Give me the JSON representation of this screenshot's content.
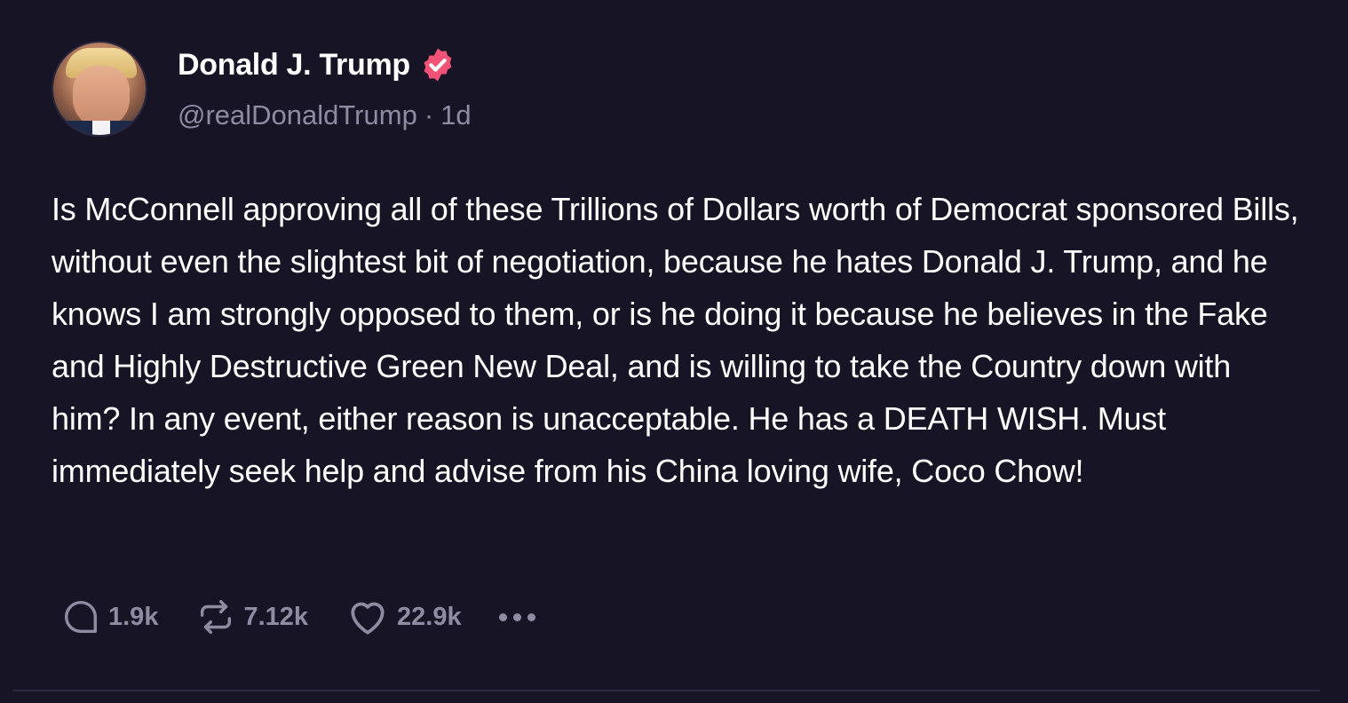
{
  "author": {
    "display_name": "Donald J. Trump",
    "handle": "@realDonaldTrump",
    "separator": "·",
    "time_ago": "1d",
    "verified": true
  },
  "post": {
    "text": "Is McConnell approving all of these Trillions of Dollars worth of Democrat sponsored Bills, without even the slightest bit of negotiation, because he hates Donald J. Trump, and he knows I am strongly opposed to them, or is he doing it because he believes in the Fake and Highly Destructive Green New Deal, and is willing to take the Country down with him? In any event, either reason is unacceptable. He has a DEATH WISH. Must immediately seek help and advise from his China loving wife, Coco Chow!"
  },
  "actions": {
    "replies": "1.9k",
    "retruths": "7.12k",
    "likes": "22.9k"
  },
  "icons": {
    "verified": "verified-badge-icon",
    "reply": "reply-bubble-icon",
    "retruth": "repost-arrows-icon",
    "like": "heart-icon",
    "more": "more-dots-icon"
  },
  "colors": {
    "background": "#171426",
    "text": "#ffffff",
    "muted": "#8f8ba3",
    "verified": "#f25276"
  }
}
